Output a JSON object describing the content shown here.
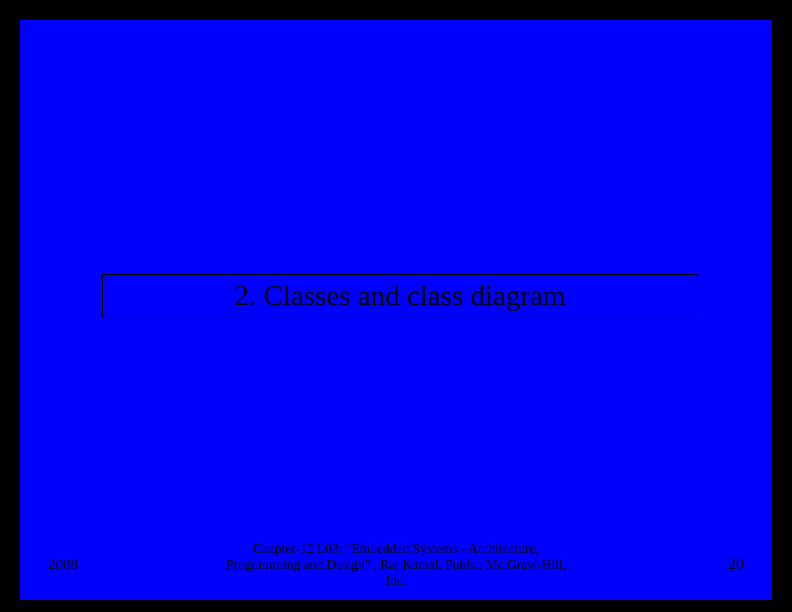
{
  "slide": {
    "title": "2. Classes and class diagram"
  },
  "footer": {
    "year": "2008",
    "reference_line1": "Chapter-12 L03: \"Embedded Systems - Architecture,",
    "reference_line2": "Programming and Design\" , Raj Kamal, Publs.: Mc.Graw-Hill,",
    "reference_line3": "Inc.",
    "page_number": "20"
  }
}
